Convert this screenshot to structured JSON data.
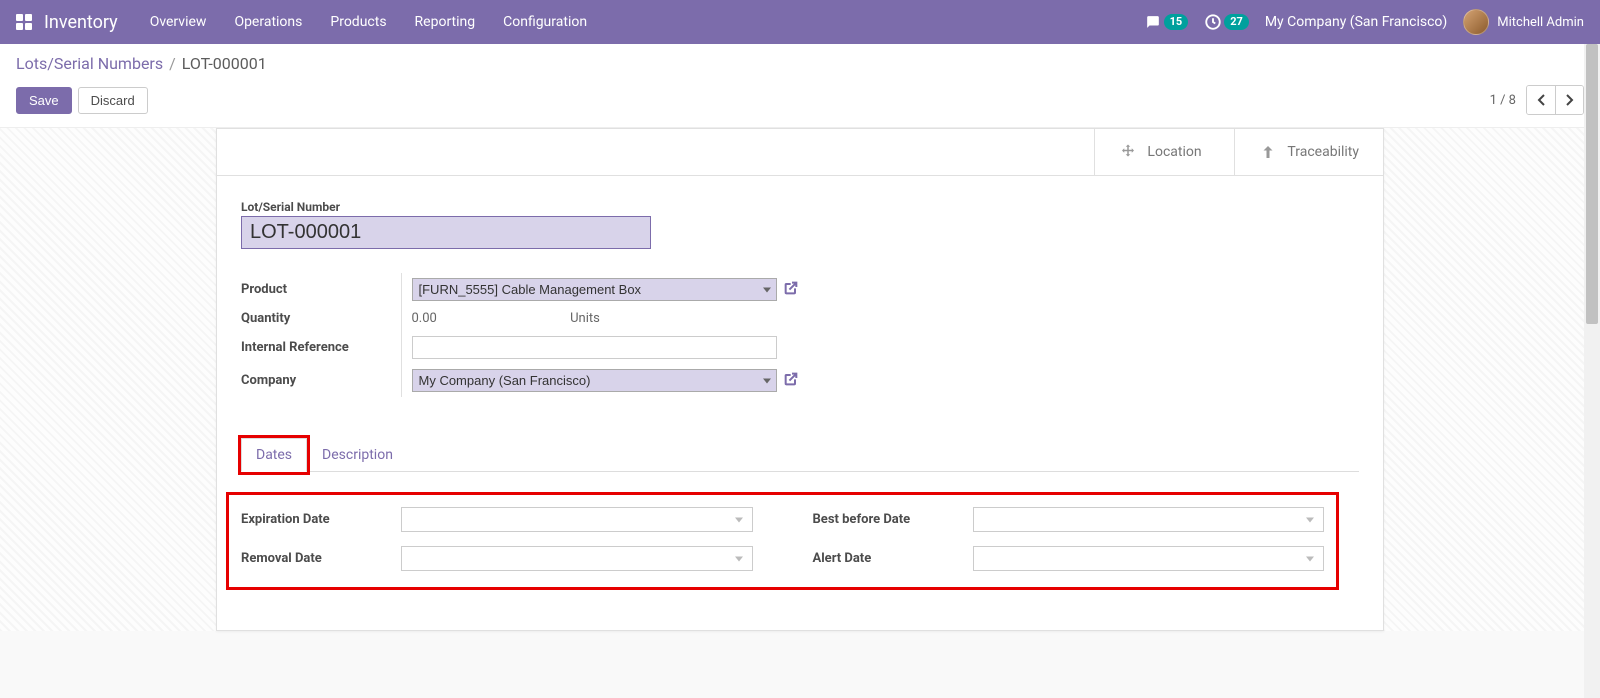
{
  "navbar": {
    "app_title": "Inventory",
    "menu": [
      "Overview",
      "Operations",
      "Products",
      "Reporting",
      "Configuration"
    ],
    "msg_count": "15",
    "activity_count": "27",
    "company": "My Company (San Francisco)",
    "user": "Mitchell Admin"
  },
  "breadcrumb": {
    "parent": "Lots/Serial Numbers",
    "current": "LOT-000001"
  },
  "buttons": {
    "save": "Save",
    "discard": "Discard"
  },
  "pager": {
    "text": "1 / 8"
  },
  "stat": {
    "location": "Location",
    "traceability": "Traceability"
  },
  "form": {
    "title_label": "Lot/Serial Number",
    "title_value": "LOT-000001",
    "labels": {
      "product": "Product",
      "quantity": "Quantity",
      "internal_ref": "Internal Reference",
      "company": "Company"
    },
    "product_value": "[FURN_5555] Cable Management Box",
    "quantity_value": "0.00",
    "quantity_unit": "Units",
    "internal_ref_value": "",
    "company_value": "My Company (San Francisco)"
  },
  "tabs": {
    "dates": "Dates",
    "description": "Description"
  },
  "dates": {
    "expiration": "Expiration Date",
    "removal": "Removal Date",
    "best_before": "Best before Date",
    "alert": "Alert Date",
    "expiration_value": "",
    "removal_value": "",
    "best_before_value": "",
    "alert_value": ""
  }
}
